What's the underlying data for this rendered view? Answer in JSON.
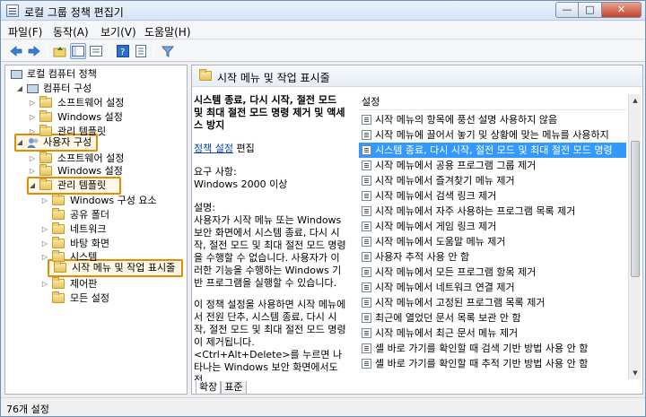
{
  "window": {
    "title": "로컬 그룹 정책 편집기",
    "minimize": "—",
    "maximize": "□",
    "close": "✕"
  },
  "menu": [
    "파일(F)",
    "동작(A)",
    "보기(V)",
    "도움말(H)"
  ],
  "tree": [
    {
      "label": "로컬 컴퓨터 정책",
      "icon": "computer-icon"
    },
    {
      "label": "컴퓨터 구성",
      "icon": "computer-icon"
    },
    {
      "label": "소프트웨어 설정",
      "icon": "folder-icon"
    },
    {
      "label": "Windows 설정",
      "icon": "folder-icon"
    },
    {
      "label": "관리 템플릿",
      "icon": "folder-icon"
    },
    {
      "label": "사용자 구성",
      "icon": "users-icon",
      "highlighted": true
    },
    {
      "label": "소프트웨어 설정",
      "icon": "folder-icon"
    },
    {
      "label": "Windows 설정",
      "icon": "folder-icon"
    },
    {
      "label": "관리 템플릿",
      "icon": "folder-icon",
      "highlighted": true
    },
    {
      "label": "Windows 구성 요소",
      "icon": "folder-icon"
    },
    {
      "label": "공유 폴더",
      "icon": "folder-icon"
    },
    {
      "label": "네트워크",
      "icon": "folder-icon"
    },
    {
      "label": "바탕 화면",
      "icon": "folder-icon"
    },
    {
      "label": "시스템",
      "icon": "folder-icon"
    },
    {
      "label": "시작 메뉴 및 작업 표시줄",
      "icon": "folder-icon",
      "highlighted": true
    },
    {
      "label": "제어판",
      "icon": "folder-icon"
    },
    {
      "label": "모든 설정",
      "icon": "folder-icon"
    }
  ],
  "right": {
    "header": "시작 메뉴 및 작업 표시줄",
    "policy_title": "시스템 종료, 다시 시작, 절전 모드 및 최대 절전 모드 명령 제거 및 액세스 방지",
    "edit_link": "정책 설정",
    "edit_suffix": " 편집",
    "req_label": "요구 사항:",
    "req_value": "Windows 2000 이상",
    "desc_label": "설명:",
    "desc_text": "사용자가 시작 메뉴 또는 Windows 보안 화면에서 시스템 종료, 다시 시작, 절전 모드 및 최대 절전 모드 명령을 수행할 수 없습니다. 사용자가 이러한 기능을 수행하는 Windows 기반 프로그램을 실행할 수 있습니다.",
    "desc_text2": "이 정책 설정을 사용하면 시작 메뉴에서 전원 단추, 시스템 종료, 다시 시작, 절전 모드 및 최대 절전 모드 명령이 제거됩니다. <Ctrl+Alt+Delete>를 누르면 나타나는 Windows 보안 화면에서도 전",
    "list_header": "설정",
    "settings": [
      "시작 메뉴의 항목에 풍선 설명 사용하지 않음",
      "시작 메뉴에 끌어서 놓기 및 상황에 맞는 메뉴를 사용하지",
      "시스템 종료, 다시 시작, 절전 모드 및 최대 절전 모드 명령",
      "시작 메뉴에서 공용 프로그램 그룹 제거",
      "시작 메뉴에서 즐겨찾기 메뉴 제거",
      "시작 메뉴에서 검색 링크 제거",
      "시작 메뉴에서 자주 사용하는 프로그램 목록 제거",
      "시작 메뉴에서 게임 링크 제거",
      "시작 메뉴에서 도움말 메뉴 제거",
      "사용자 추적 사용 안 함",
      "시작 메뉴에서 모든 프로그램 항목 제거",
      "시작 메뉴에서 네트워크 연결 제거",
      "시작 메뉴에서 고정된 프로그램 목록 제거",
      "최근에 열었던 문서 목록 보관 안 함",
      "시작 메뉴에서 최근 문서 메뉴 제거",
      "셸 바로 가기를 확인할 때 검색 기반 방법 사용 안 함",
      "셸 바로 가기를 확인할 때 추적 기반 방법 사용 안 함"
    ],
    "selected_index": 2,
    "tabs": [
      "확장",
      "표준"
    ]
  },
  "status": "76개 설정"
}
